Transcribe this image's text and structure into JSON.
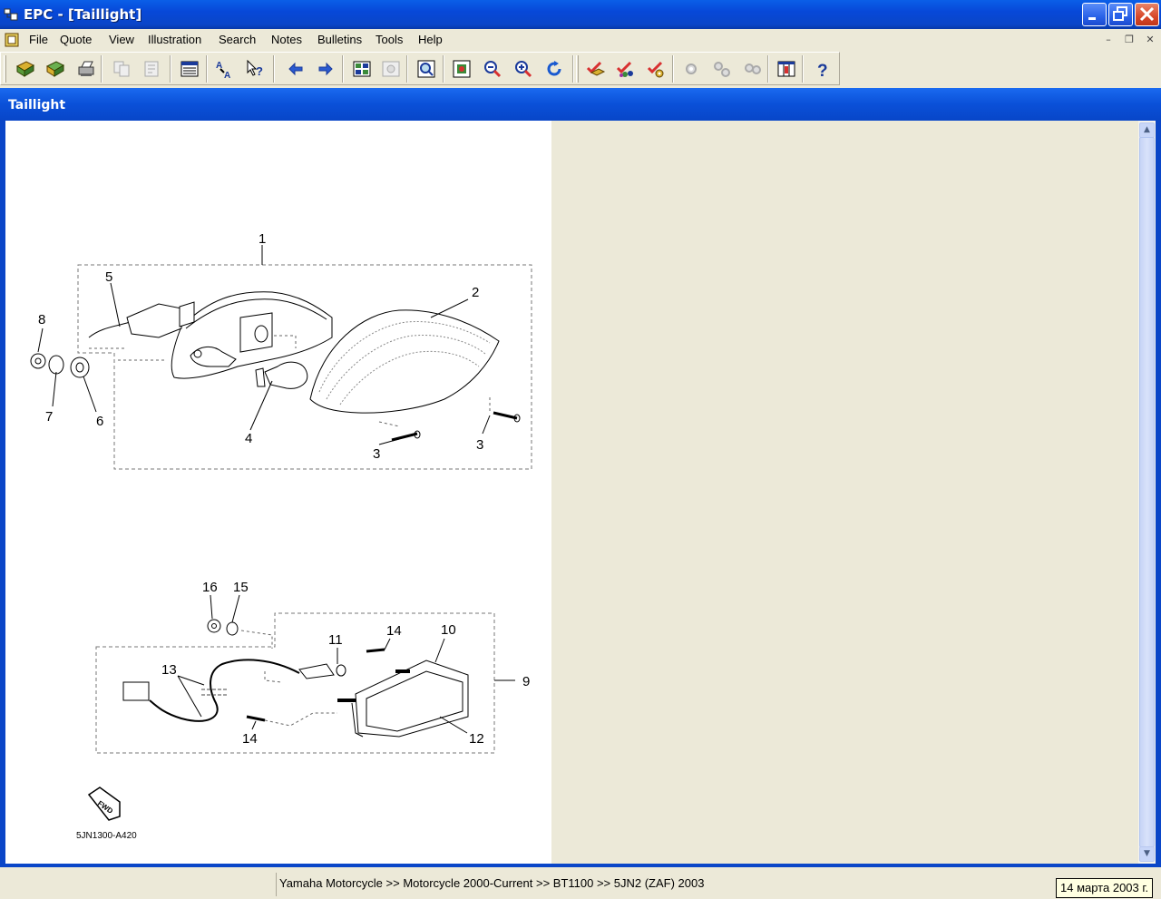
{
  "window": {
    "title": "EPC - [Taillight]"
  },
  "menu": [
    "File",
    "Quote",
    "View",
    "Illustration",
    "Search",
    "Notes",
    "Bulletins",
    "Tools",
    "Help"
  ],
  "mdi_controls": {
    "minimize": "–",
    "restore": "❐",
    "close": "✕"
  },
  "toolbar": [
    "open-book-icon",
    "bookmark-book-icon",
    "print-icon",
    "copy-disabled-icon",
    "paste-disabled-icon",
    "list-view-icon",
    "find-replace-icon",
    "help-pointer-icon",
    "back-arrow-icon",
    "forward-arrow-icon",
    "grid-view-icon",
    "grid-view-disabled-icon",
    "zoom-page-icon",
    "zoom-fit-icon",
    "zoom-out-icon",
    "zoom-in-icon",
    "refresh-icon",
    "check-add-icon",
    "check-multi-icon",
    "check-settings-icon",
    "gear-disabled-icon",
    "gears-disabled-icon",
    "gears-settings-disabled-icon",
    "columns-icon",
    "help-icon"
  ],
  "panel": {
    "title": "Taillight"
  },
  "drawing": {
    "callouts": [
      "1",
      "2",
      "3",
      "3",
      "4",
      "5",
      "6",
      "7",
      "8",
      "9",
      "10",
      "11",
      "12",
      "13",
      "14",
      "14",
      "15",
      "16"
    ],
    "fwd_label": "FWD",
    "drawing_code": "5JN1300-A420"
  },
  "scrollbar": {
    "up": "▲",
    "down": "▼"
  },
  "status": {
    "breadcrumb": "Yamaha Motorcycle >> Motorcycle 2000-Current >> BT1100 >> 5JN2 (ZAF) 2003",
    "date": "14 марта 2003 г."
  },
  "colors": {
    "titlebar": "#0a50d8",
    "chrome": "#ece9d8",
    "close_button": "#d8482a"
  }
}
